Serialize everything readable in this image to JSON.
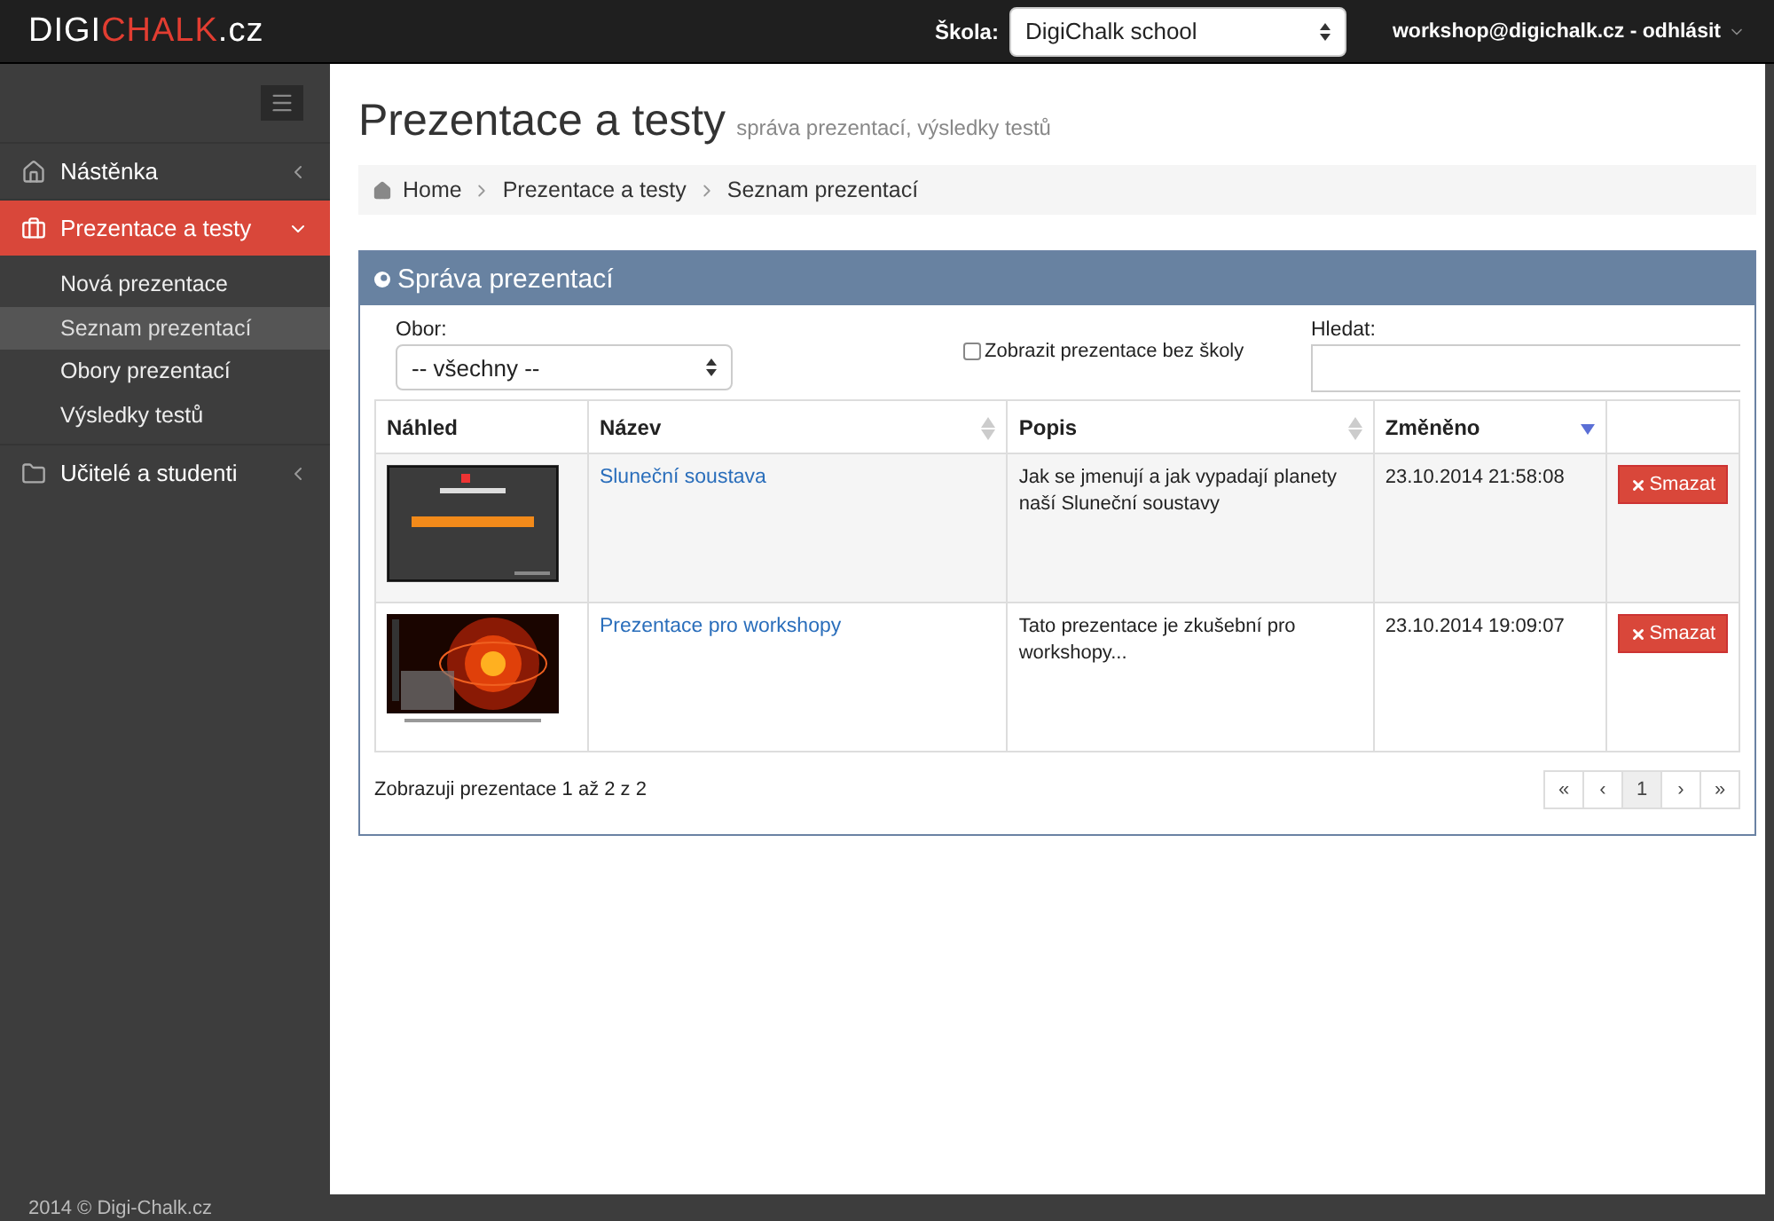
{
  "topbar": {
    "logo": [
      {
        "text": "DIGI",
        "accent": false
      },
      {
        "text": "CHALK",
        "accent": true
      },
      {
        "text": ".cz",
        "accent": false
      }
    ],
    "school_label": "Škola:",
    "school_select": "DigiChalk school",
    "user": "workshop@digichalk.cz - odhlásit"
  },
  "sidebar": {
    "items": [
      {
        "label": "Nástěnka",
        "selected": false,
        "expanded": false
      },
      {
        "label": "Prezentace a testy",
        "selected": true,
        "expanded": true,
        "children": [
          {
            "label": "Nová prezentace",
            "selected": false
          },
          {
            "label": "Seznam prezentací",
            "selected": true
          },
          {
            "label": "Obory prezentací",
            "selected": false
          },
          {
            "label": "Výsledky testů",
            "selected": false
          }
        ]
      },
      {
        "label": "Učitelé a studenti",
        "selected": false,
        "expanded": false
      }
    ],
    "footer": "2014 © Digi-Chalk.cz"
  },
  "page": {
    "title": "Prezentace a testy",
    "subtitle": "správa prezentací, výsledky testů",
    "breadcrumb": [
      "Home",
      "Prezentace a testy",
      "Seznam prezentací"
    ]
  },
  "panel": {
    "title": "Správa prezentací",
    "filter_label": "Obor:",
    "filter_select": "-- všechny --",
    "checkbox": {
      "label": "Zobrazit prezentace bez školy",
      "checked": false
    },
    "search_label": "Hledat:",
    "table": {
      "columns": [
        {
          "label": "Náhled",
          "kind": "plain"
        },
        {
          "label": "Název",
          "kind": "sortable"
        },
        {
          "label": "Popis",
          "kind": "sortable"
        },
        {
          "label": "Změněno",
          "kind": "sorted"
        },
        {
          "kind": "plain"
        }
      ],
      "rows": [
        {
          "name": "Sluneční soustava",
          "description": "Jak se jmenují a jak vypadají planety naší Sluneční soustavy",
          "changed": "23.10.2014 21:58:08",
          "action": "Smazat"
        },
        {
          "name": "Prezentace pro workshopy",
          "description": "Tato prezentace je zkušební pro workshopy...",
          "changed": "23.10.2014 19:09:07",
          "action": "Smazat"
        }
      ]
    },
    "info": "Zobrazuji prezentace 1 až 2 z 2",
    "pagination": [
      {
        "label": "«",
        "selected": false
      },
      {
        "label": "‹",
        "selected": false
      },
      {
        "label": "1",
        "selected": true
      },
      {
        "label": "›",
        "selected": false
      },
      {
        "label": "»",
        "selected": false
      }
    ]
  }
}
